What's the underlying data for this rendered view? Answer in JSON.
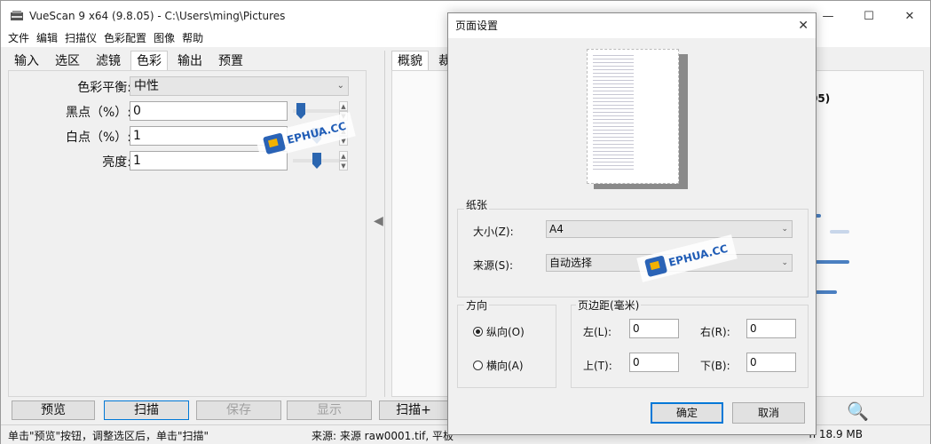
{
  "window": {
    "title": "VueScan 9 x64 (9.8.05) - C:\\Users\\ming\\Pictures",
    "minimize": "—",
    "maximize": "☐",
    "close": "✕"
  },
  "menu": [
    "文件",
    "编辑",
    "扫描仪",
    "色彩配置",
    "图像",
    "帮助"
  ],
  "left_tabs": [
    "输入",
    "选区",
    "滤镜",
    "色彩",
    "输出",
    "预置"
  ],
  "right_tabs": [
    "概貌",
    "裁"
  ],
  "color": {
    "balance_label": "色彩平衡:",
    "balance_value": "中性",
    "black_label": "黑点（%）:",
    "black_value": "0",
    "white_label": "白点（%）:",
    "white_value": "1",
    "brightness_label": "亮度:",
    "brightness_value": "1"
  },
  "right_partial": "05)",
  "buttons": {
    "preview": "预览",
    "scan": "扫描",
    "save": "保存",
    "display": "显示",
    "scan_plus": "扫描+"
  },
  "status": {
    "left": "单击\"预览\"按钮，调整选区后，单击\"扫描\"",
    "mid": "来源: 来源 raw0001.tif, 平板",
    "right": "n 18.9 MB"
  },
  "dialog": {
    "title": "页面设置",
    "close": "✕",
    "paper_group": "纸张",
    "size_label": "大小(Z):",
    "size_value": "A4",
    "source_label": "来源(S):",
    "source_value": "自动选择",
    "orientation_group": "方向",
    "portrait": "纵向(O)",
    "landscape": "横向(A)",
    "margins_group": "页边距(毫米)",
    "left_label": "左(L):",
    "left_value": "0",
    "right_label": "右(R):",
    "right_value": "0",
    "top_label": "上(T):",
    "top_value": "0",
    "bottom_label": "下(B):",
    "bottom_value": "0",
    "ok": "确定",
    "cancel": "取消"
  },
  "watermark": "EPHUA.CC",
  "icons": [
    "vuescan-app-icon",
    "zoom-icon",
    "chevron-down-icon",
    "left-arrow-icon"
  ]
}
